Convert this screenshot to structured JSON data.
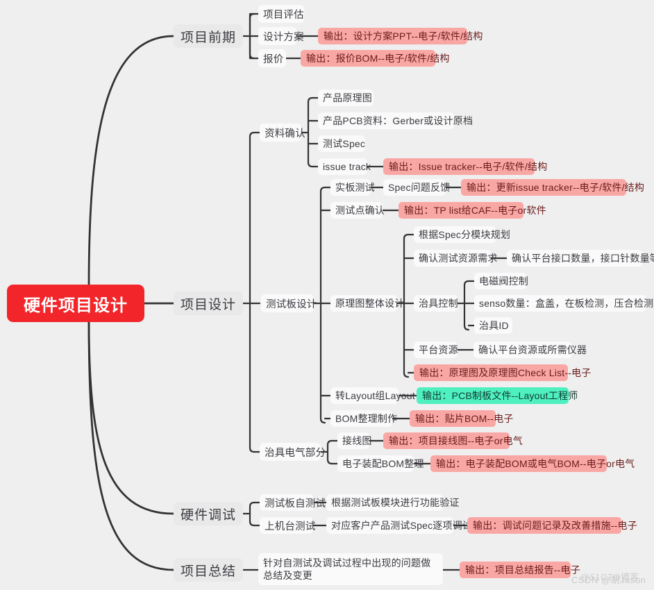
{
  "theme": {
    "background": "#efefef",
    "root_fill": "#f2252a",
    "root_text": "#ffffff",
    "node_fill": "#fafafa",
    "branch_fill": "#e9e9e9",
    "node_text": "#3b3b42",
    "output_fill": "#f9a7a5",
    "output_text": "#6b1b1b",
    "output_green_fill": "#4ef0c0",
    "output_green_text": "#113a31",
    "link_color": "#333333"
  },
  "root": {
    "label": "硬件项目设计"
  },
  "branches": {
    "b1": {
      "label": "项目前期"
    },
    "b2": {
      "label": "项目设计"
    },
    "b3": {
      "label": "硬件调试"
    },
    "b4": {
      "label": "项目总结"
    }
  },
  "nodes": {
    "n_pingu": "项目评估",
    "n_sheji": "设计方案",
    "n_sheji_out": "输出：设计方案PPT--电子/软件/结构",
    "n_baojia": "报价",
    "n_baojia_out": "输出：报价BOM--电子/软件/结构",
    "n_ziliao": "资料确认",
    "n_yuanli": "产品原理图",
    "n_pcb": "产品PCB资料：Gerber或设计原档",
    "n_spec": "测试Spec",
    "n_issue": "issue track",
    "n_issue_out": "输出：Issue tracker--电子/软件/结构",
    "n_cesbansheji": "测试板设计",
    "n_shiban": "实板测试",
    "n_specfankui": "Spec问题反馈",
    "n_specfankui_out": "输出：更新issue tracker--电子/软件/结构",
    "n_cedianqueren": "测试点确认",
    "n_cedianqueren_out": "输出：TP list给CAF--电子or软件",
    "n_yuanlizhengti": "原理图整体设计",
    "n_fenmokuai": "根据Spec分模块规划",
    "n_ziyuanxuqiu": "确认测试资源需求",
    "n_jiekoushuliang": "确认平台接口数量，接口针数量等",
    "n_zhijukongzhi": "治具控制",
    "n_diancifa": "电磁阀控制",
    "n_senso": "senso数量：盒盖，在板检测，压合检测。。。",
    "n_zhijuid": "治具ID",
    "n_pingtaiziyuan": "平台资源",
    "n_pingtaiziyuan_sub": "确认平台资源或所需仪器",
    "n_yuanli_out": "输出：原理图及原理图Check List--电子",
    "n_layout": "转Layout组Layout",
    "n_layout_out": "输出：PCB制板文件--Layout工程师",
    "n_bom": "BOM整理制作",
    "n_bom_out": "输出：贴片BOM--电子",
    "n_zhijudianqi": "治具电气部分",
    "n_jiexiantu": "接线图",
    "n_jiexiantu_out": "输出：项目接线图--电子or电气",
    "n_zhuangpeibom": "电子装配BOM整理",
    "n_zhuangpeibom_out": "输出：电子装配BOM或电气BOM--电子or电气",
    "n_cesbanzi": "测试板自测试",
    "n_gongneng": "根据测试板模块进行功能验证",
    "n_shangjitai": "上机台测试",
    "n_zhuxiang": "对应客户产品测试Spec逐项调试",
    "n_zhuxiang_out": "输出：调试问题记录及改善措施--电子",
    "n_zongjie": "针对自测试及调试过程中出现的问题做总结及变更",
    "n_zongjie_out": "输出：项目总结报告--电子"
  },
  "watermarks": {
    "primary": "CSDN @胡Jason",
    "secondary": "@51CTO博客"
  }
}
